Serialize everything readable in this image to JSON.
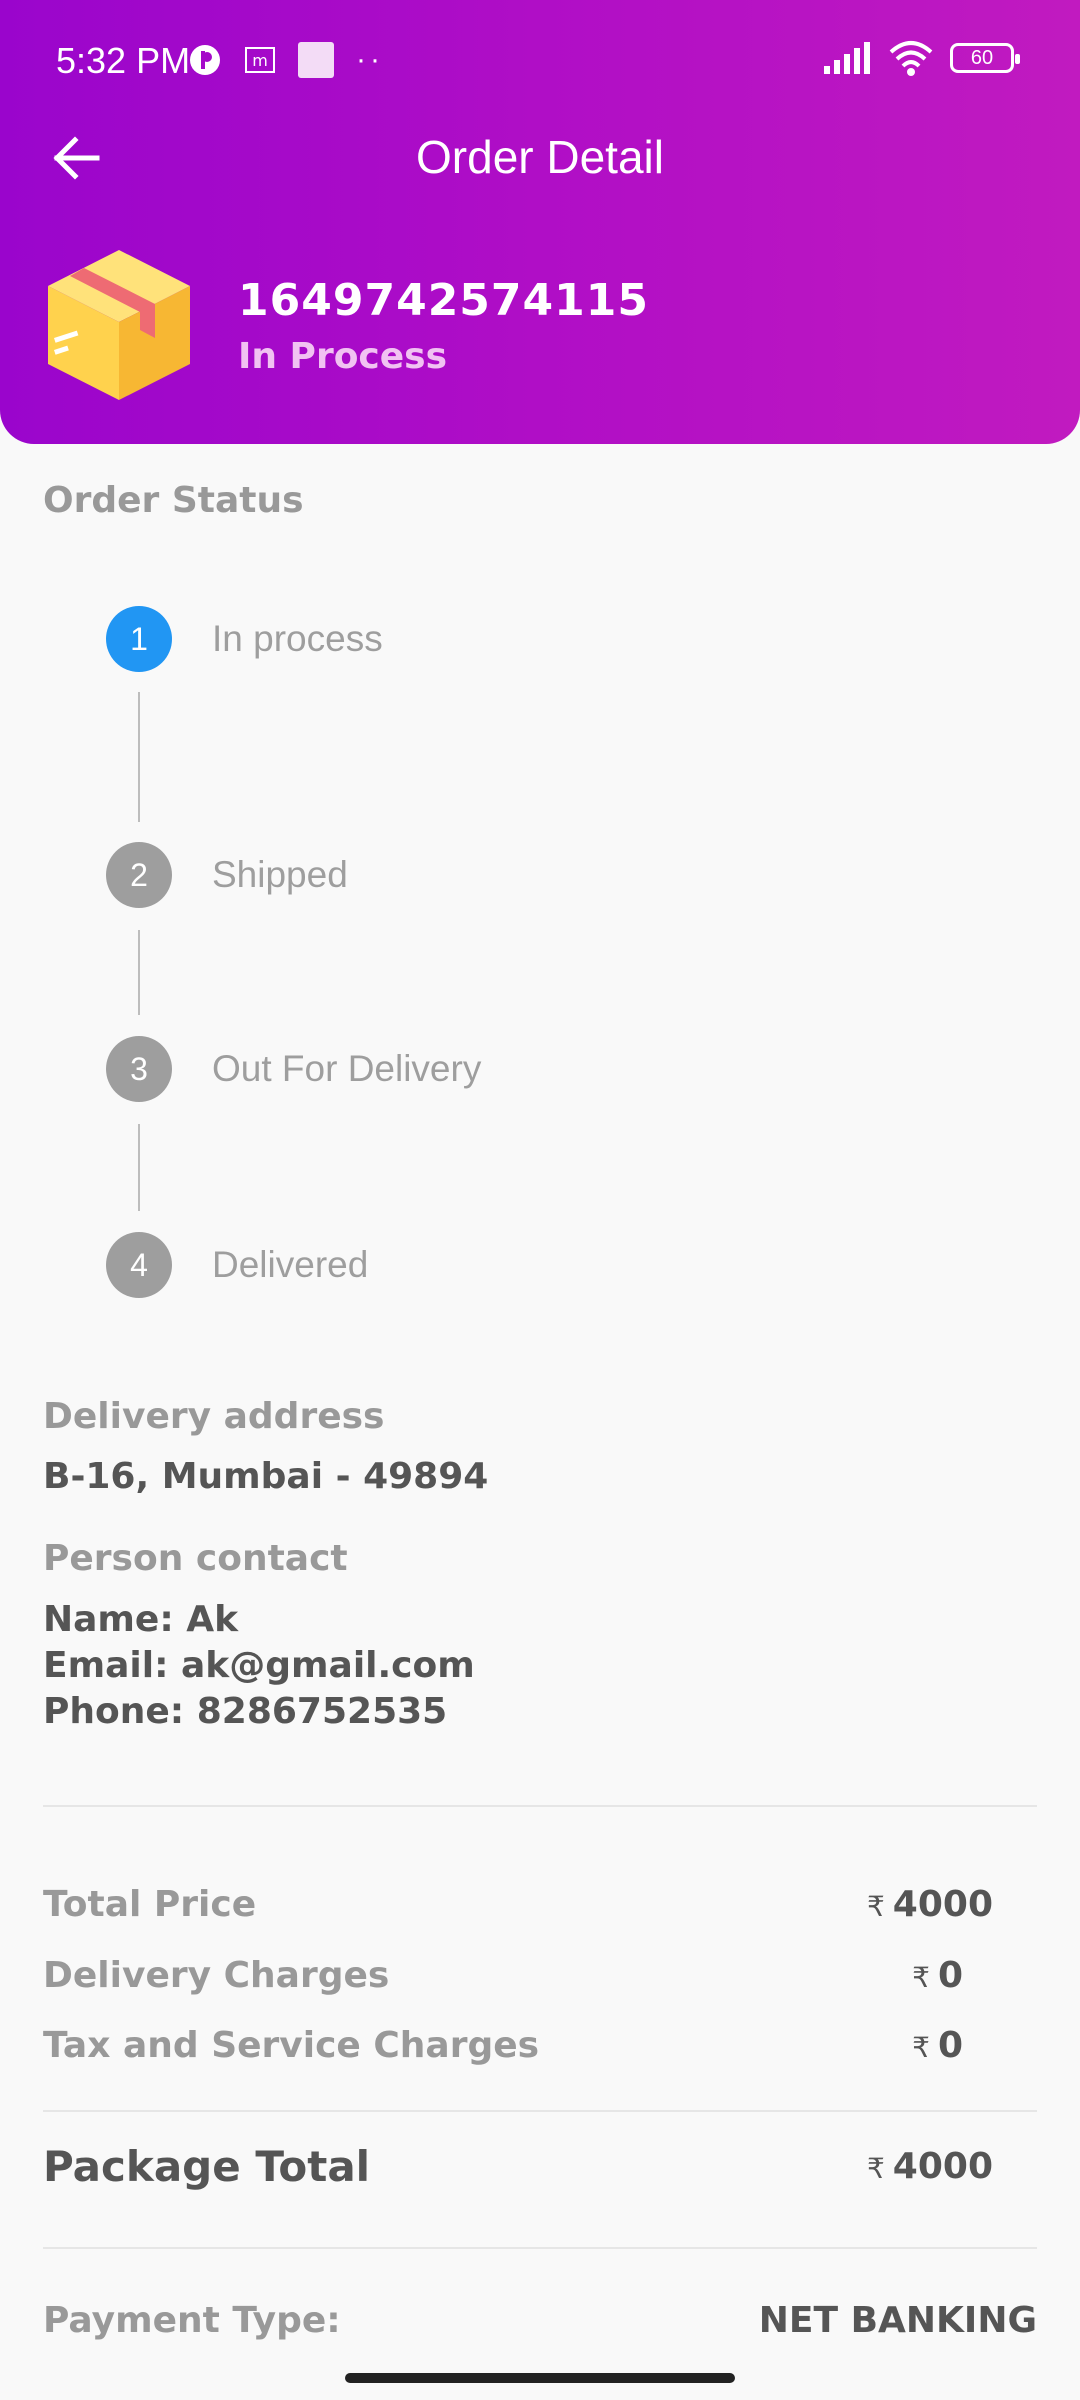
{
  "status_bar": {
    "time": "5:32 PM",
    "battery": "60",
    "icons_left": [
      "p-circle-icon",
      "m-box-icon",
      "square-icon",
      "dots-icon"
    ],
    "icons_right": [
      "signal-icon",
      "wifi-icon",
      "battery-icon"
    ]
  },
  "header": {
    "title": "Order Detail",
    "order_id": "1649742574115",
    "order_state": "In Process",
    "gradient": [
      "#9a05cc",
      "#c11ac0"
    ]
  },
  "order_status": {
    "label": "Order Status",
    "steps": [
      {
        "num": "1",
        "label": "In process",
        "active": true
      },
      {
        "num": "2",
        "label": "Shipped",
        "active": false
      },
      {
        "num": "3",
        "label": "Out For Delivery",
        "active": false
      },
      {
        "num": "4",
        "label": "Delivered",
        "active": false
      }
    ],
    "active_color": "#2196f3",
    "inactive_color": "#9e9e9e"
  },
  "delivery": {
    "label": "Delivery address",
    "address": "B-16, Mumbai - 49894"
  },
  "contact": {
    "label": "Person contact",
    "name": "Name: Ak",
    "email": "Email: ak@gmail.com",
    "phone": "Phone: 8286752535"
  },
  "pricing": {
    "currency": "₹",
    "rows": [
      {
        "label": "Total Price",
        "value": "4000"
      },
      {
        "label": "Delivery Charges",
        "value": "0"
      },
      {
        "label": "Tax and Service Charges",
        "value": "0"
      }
    ],
    "total_label": "Package Total",
    "total_value": "4000"
  },
  "payment": {
    "label": "Payment Type:",
    "value": "NET BANKING"
  }
}
